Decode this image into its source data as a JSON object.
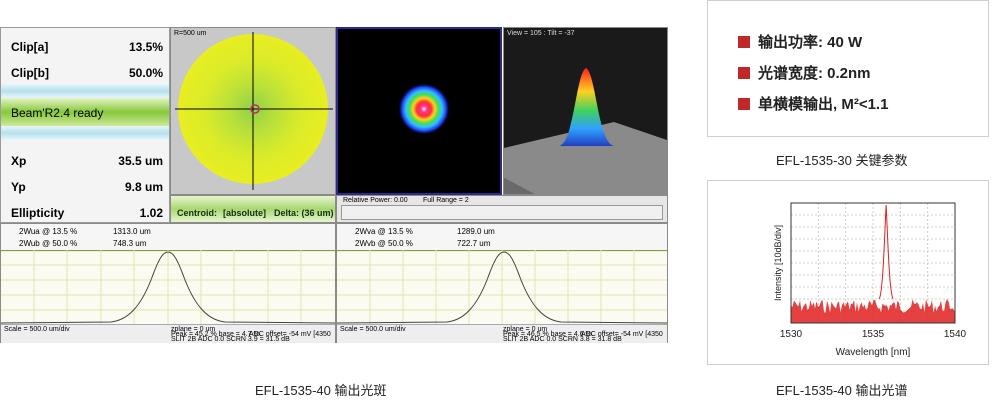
{
  "metrics": {
    "clip_a": {
      "label": "Clip[a]",
      "value": "13.5%"
    },
    "clip_b": {
      "label": "Clip[b]",
      "value": "50.0%"
    },
    "status": "Beam'R2.4 ready",
    "xp": {
      "label": "Xp",
      "value": "35.5 um"
    },
    "yp": {
      "label": "Yp",
      "value": "9.8 um"
    },
    "ellipticity": {
      "label": "Ellipticity",
      "value": "1.02"
    }
  },
  "spot_view": {
    "label": "R=500 um"
  },
  "view3d": {
    "label": "View = 105 : Tilt = -37"
  },
  "centroid_bar": {
    "centroid_label": "Centroid:",
    "centroid_mode": "[absolute]",
    "delta": "Delta: (36 um)"
  },
  "power_bar": {
    "relative_power": "Relative Power: 0.00",
    "full_range": "Full Range = 2"
  },
  "profile_a": {
    "w1_label": "2Wua @ 13.5 %",
    "w1_value": "1313.0 um",
    "w2_label": "2Wub @ 50.0 %",
    "w2_value": "748.3 um",
    "scale": "Scale = 500.0 um/div",
    "zplane": "zplane = 0 um",
    "peak": "Peak = 45.2 %  base = 4.7 %",
    "adc": "ADC offset= -54 mV [4350",
    "slit": "SLIT 2B ADC 0.0 SCRN 3.9 = 31.5 dB"
  },
  "profile_b": {
    "w1_label": "2Wva @ 13.5 %",
    "w1_value": "1289.0 um",
    "w2_label": "2Wvb @ 50.0 %",
    "w2_value": "722.7 um",
    "scale": "Scale = 500.0 um/div",
    "zplane": "zplane = 0 um",
    "peak": "Peak = 46.5 %  base = 4.6 %",
    "adc": "ADC offset= -54 mV [4350",
    "slit": "SLIT 2B ADC 0.0 SCRN 3.8 = 31.8 dB"
  },
  "captions": {
    "beam": "EFL-1535-40 输出光斑",
    "specs": "EFL-1535-30 关键参数",
    "spectrum": "EFL-1535-40 输出光谱"
  },
  "specs": [
    "输出功率: 40 W",
    "光谱宽度: 0.2nm",
    "单横模输出, M²<1.1"
  ],
  "colors": {
    "accent_red": "#c0282c",
    "spectrum_line": "#e02020"
  },
  "chart_data": {
    "type": "line",
    "xlabel": "Wavelength [nm]",
    "ylabel": "Intensity [10dB/div]",
    "x_ticks": [
      "1530",
      "1535",
      "1540"
    ],
    "xlim": [
      1530,
      1540
    ],
    "peak_x": 1535.8,
    "grid": true
  }
}
